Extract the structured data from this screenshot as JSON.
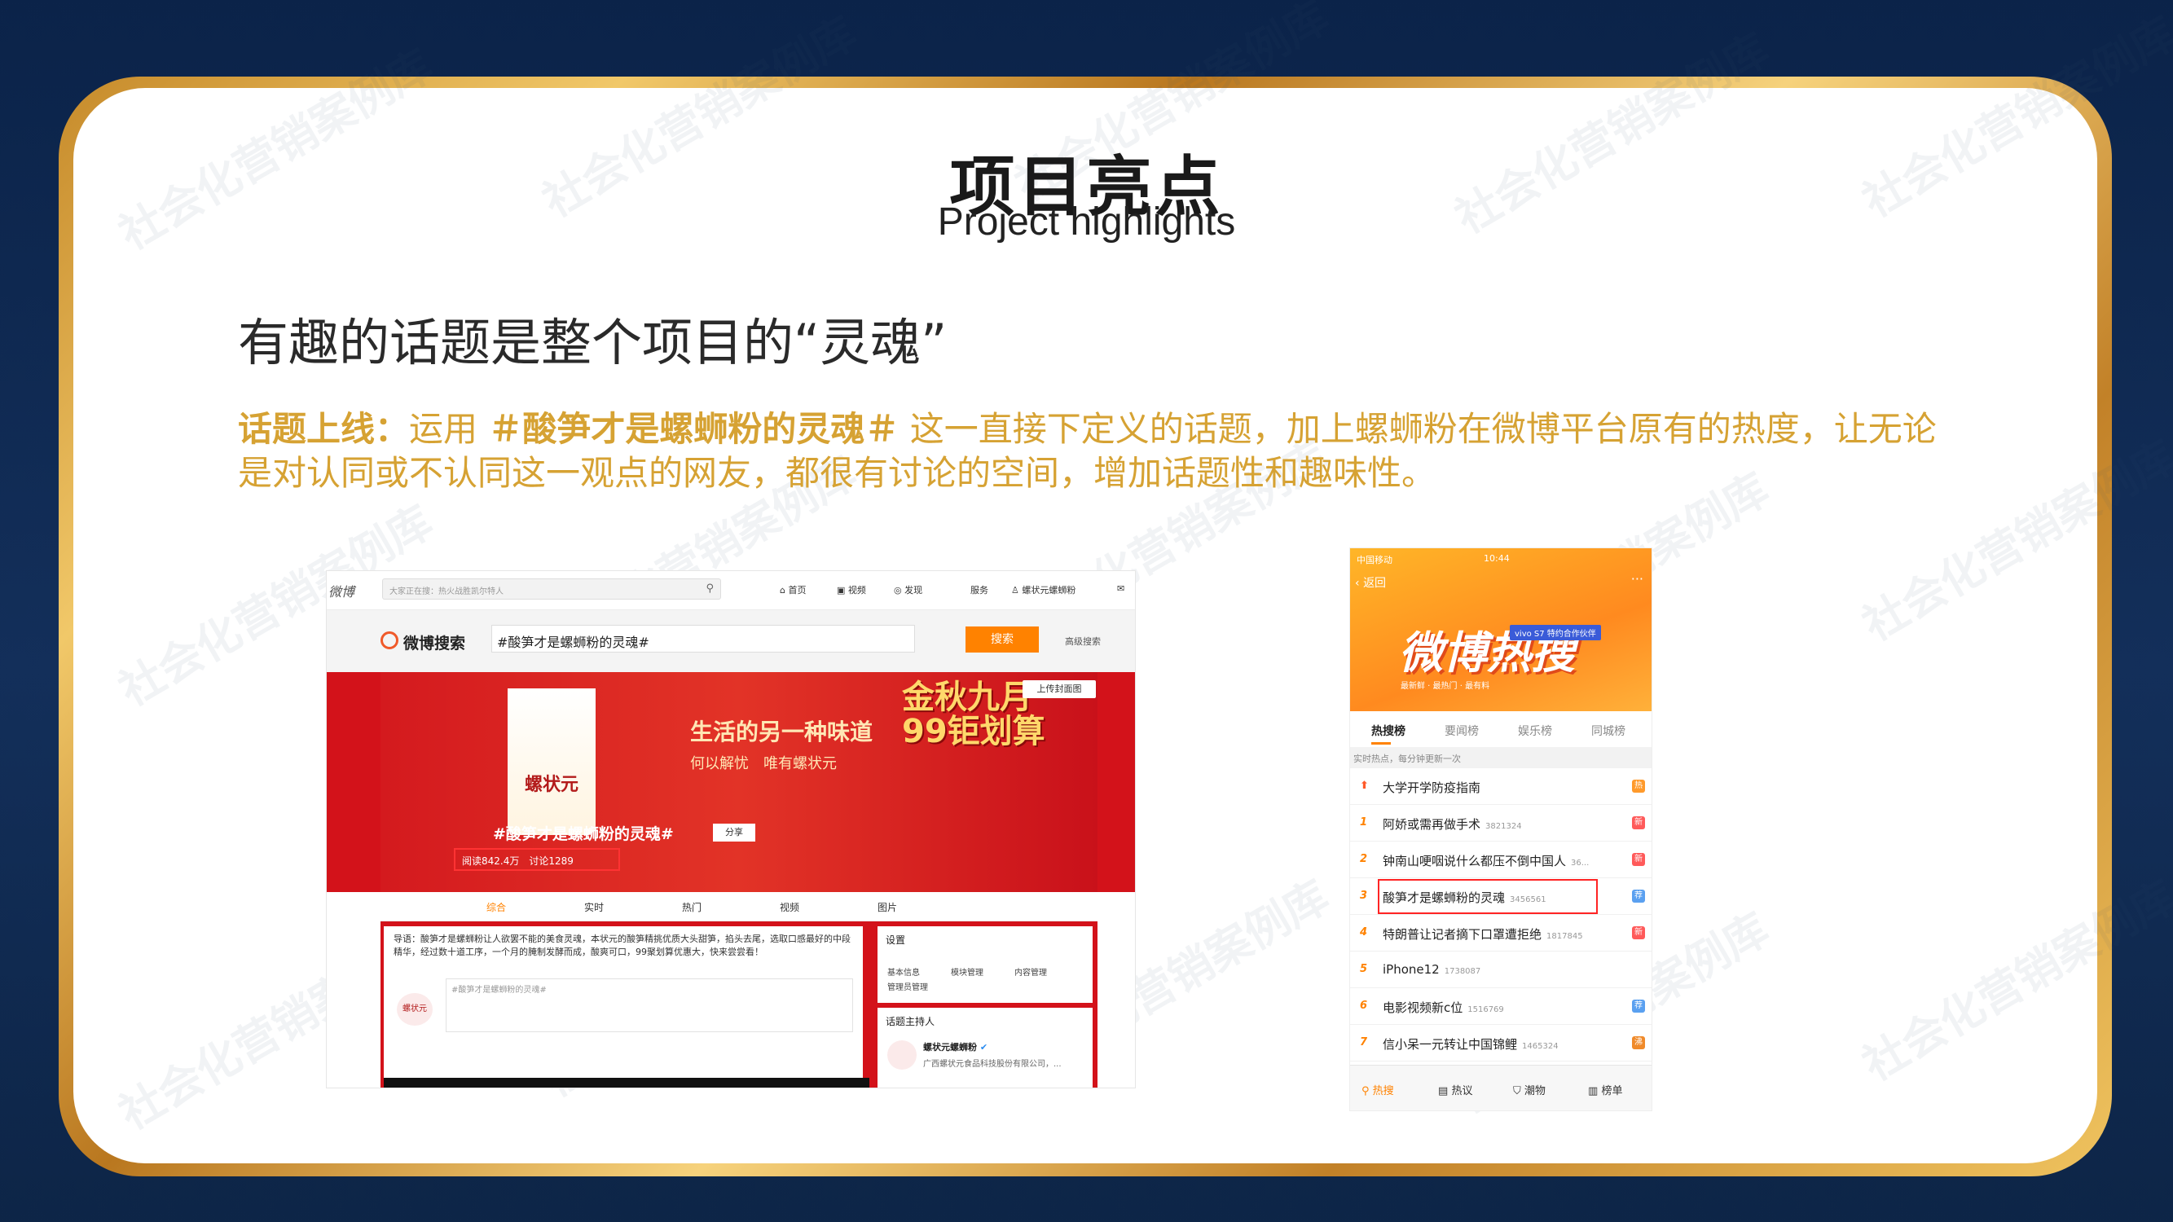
{
  "watermark": "社会化营销案例库",
  "header": {
    "title": "项目亮点",
    "subtitle_en": "Project highlights"
  },
  "slide": {
    "subtitle": "有趣的话题是整个项目的“灵魂”",
    "body_lead": "话题上线：",
    "body_text_1": "运用",
    "body_topic": "＃酸笋才是螺蛳粉的灵魂＃",
    "body_text_2": "这一直接下定义的话题，加上螺蛳粉在微博平台原有的热度，让无论是对认同或不认同这一观点的网友，都很有讨论的空间，增加话题性和趣味性。"
  },
  "weibo_search": {
    "nav": {
      "logo": "微博",
      "search_placeholder": "大家正在搜：热火战胜凯尔特人",
      "home": "首页",
      "video": "视频",
      "discover": "发现",
      "service": "服务",
      "account": "螺状元螺蛳粉"
    },
    "bar": {
      "label": "微博搜索",
      "query": "#酸笋才是螺蛳粉的灵魂#",
      "search_button": "搜索",
      "advanced": "高级搜索"
    },
    "banner": {
      "brand": "螺状元",
      "slogan_1": "生活的另一种味道",
      "slogan_2": "何以解忧　唯有螺状元",
      "promo": "金秋九月\n99钜划算",
      "upload_cover": "上传封面图",
      "topic": "#酸笋才是螺蛳粉的灵魂#",
      "share": "分享",
      "stats": "阅读842.4万　讨论1289"
    },
    "tabs": [
      "综合",
      "实时",
      "热门",
      "视频",
      "图片"
    ],
    "guide": "导语：酸笋才是螺蛳粉让人欲罢不能的美食灵魂，本状元的酸笋精挑优质大头甜笋，掐头去尾，选取口感最好的中段精华，经过数十道工序，一个月的腌制发酵而成，酸爽可口，99聚划算优惠大，快来尝尝看！",
    "composer_placeholder": "#酸笋才是螺蛳粉的灵魂#",
    "composer_logo": "螺状元",
    "settings": {
      "title": "设置",
      "items": [
        "基本信息",
        "模块管理",
        "内容管理",
        "管理员管理"
      ]
    },
    "host": {
      "title": "话题主持人",
      "name": "螺状元螺蛳粉",
      "company": "广西螺状元食品科技股份有限公司，..."
    }
  },
  "weibo_hot": {
    "status_left": "中国移动",
    "time": "10:44",
    "back": "返回",
    "more": "···",
    "banner_title": "微博热搜",
    "sponsor": "vivo S7 特约合作伙伴",
    "tagline": "最新鲜 · 最热门 · 最有料",
    "tabs": [
      "热搜榜",
      "要闻榜",
      "娱乐榜",
      "同城榜"
    ],
    "hint": "实时热点，每分钟更新一次",
    "rows": [
      {
        "rank": "⬆",
        "title": "大学开学防疫指南",
        "count": "",
        "badge": "热",
        "badge_color": "#ff9a2b"
      },
      {
        "rank": "1",
        "title": "阿娇或需再做手术",
        "count": "3821324",
        "badge": "新",
        "badge_color": "#ff5a5a"
      },
      {
        "rank": "2",
        "title": "钟南山哽咽说什么都压不倒中国人",
        "count": "36...",
        "badge": "新",
        "badge_color": "#ff5a5a"
      },
      {
        "rank": "3",
        "title": "酸笋才是螺蛳粉的灵魂",
        "count": "3456561",
        "badge": "荐",
        "badge_color": "#5aa0f0"
      },
      {
        "rank": "4",
        "title": "特朗普让记者摘下口罩遭拒绝",
        "count": "1817845",
        "badge": "新",
        "badge_color": "#ff5a5a"
      },
      {
        "rank": "5",
        "title": "iPhone12",
        "count": "1738087",
        "badge": "",
        "badge_color": ""
      },
      {
        "rank": "6",
        "title": "电影视频新c位",
        "count": "1516769",
        "badge": "荐",
        "badge_color": "#5aa0f0"
      },
      {
        "rank": "7",
        "title": "信小呆一元转让中国锦鲤",
        "count": "1465324",
        "badge": "沸",
        "badge_color": "#f08a2a"
      }
    ],
    "bottom": [
      "热搜",
      "热议",
      "潮物",
      "榜单"
    ]
  }
}
